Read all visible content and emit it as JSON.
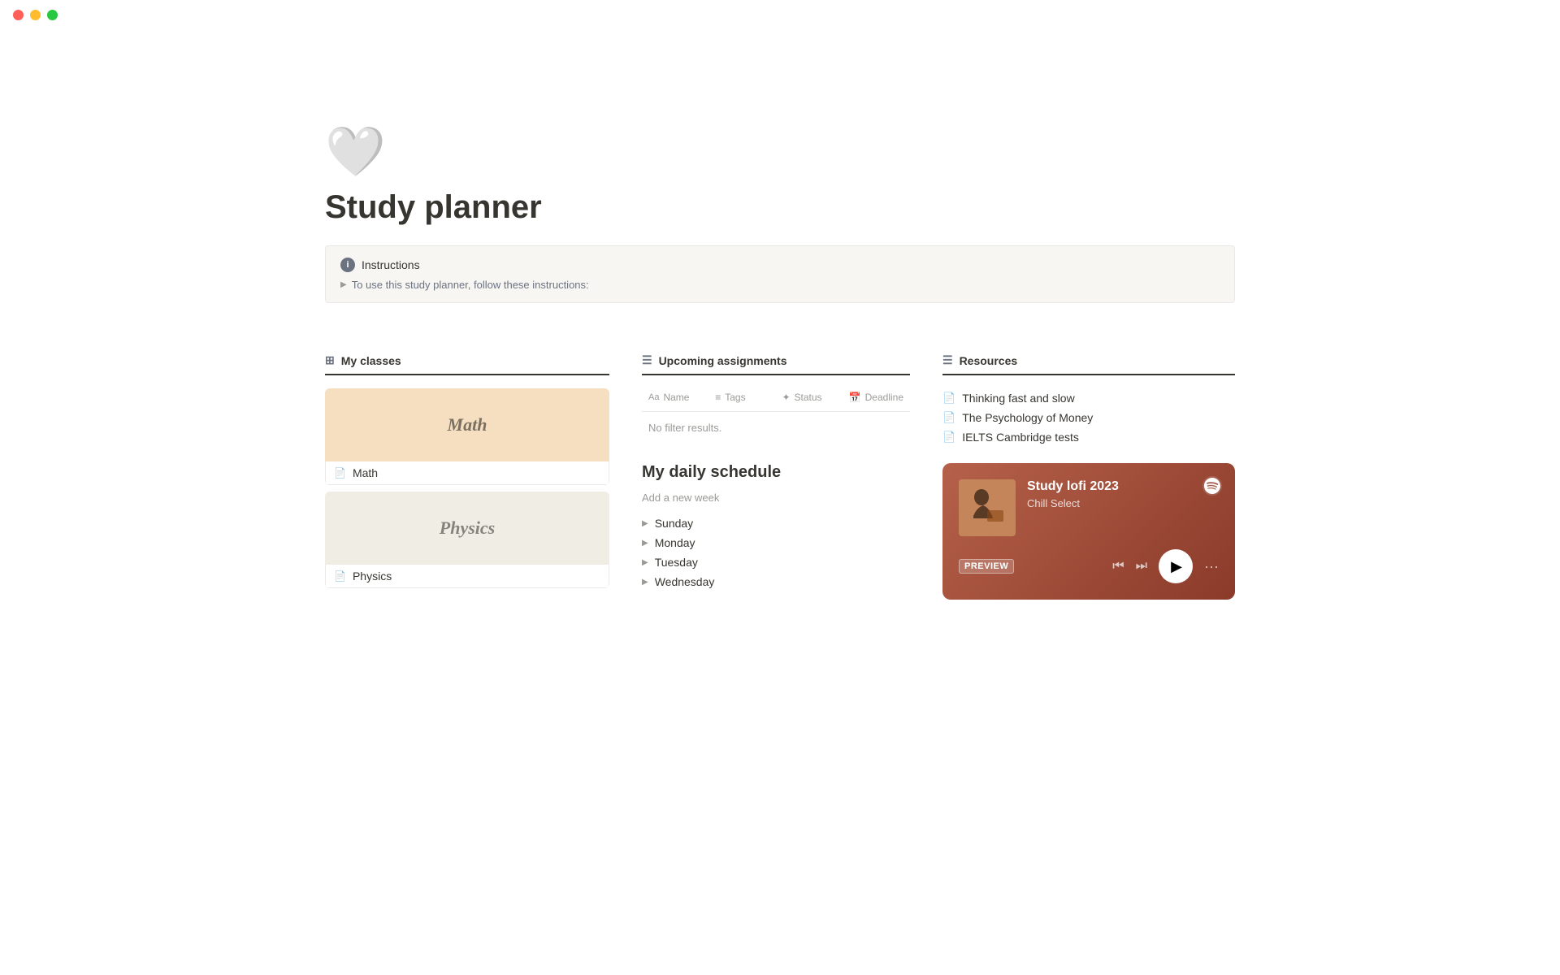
{
  "titlebar": {
    "buttons": [
      "close",
      "minimize",
      "maximize"
    ]
  },
  "hero": {
    "emoji": "🤍",
    "title": "Study planner"
  },
  "callout": {
    "icon": "i",
    "header": "Instructions",
    "toggle_text": "To use this study planner, follow these instructions:"
  },
  "classes": {
    "section_label": "My classes",
    "items": [
      {
        "name": "Math",
        "style": "math"
      },
      {
        "name": "Physics",
        "style": "physics"
      }
    ]
  },
  "assignments": {
    "section_label": "Upcoming assignments",
    "columns": [
      "Name",
      "Tags",
      "Status",
      "Deadline"
    ],
    "empty_text": "No filter results.",
    "schedule": {
      "title": "My daily schedule",
      "add_week": "Add a new week",
      "days": [
        "Sunday",
        "Monday",
        "Tuesday",
        "Wednesday"
      ]
    }
  },
  "resources": {
    "section_label": "Resources",
    "items": [
      "Thinking fast and slow",
      "The Psychology of Money",
      "IELTS Cambridge tests"
    ],
    "spotify": {
      "title": "Study lofi 2023",
      "subtitle": "Chill Select",
      "preview_label": "PREVIEW"
    }
  }
}
